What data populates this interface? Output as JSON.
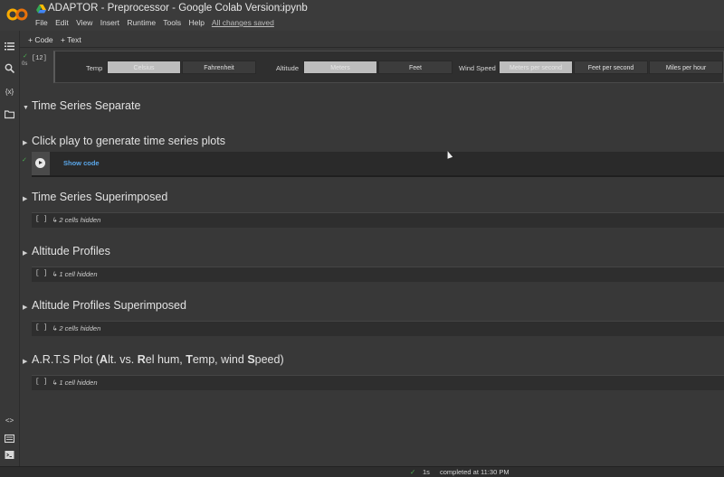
{
  "header": {
    "title": "ADAPTOR - Preprocessor - Google Colab Version.ipynb",
    "menu": [
      "File",
      "Edit",
      "View",
      "Insert",
      "Runtime",
      "Tools",
      "Help"
    ],
    "saved_status": "All changes saved"
  },
  "toolbar": {
    "code_label": "+ Code",
    "text_label": "+ Text"
  },
  "cell": {
    "exec_count": "[12]",
    "temp_label": "Temp",
    "temp_options": [
      "Celsius",
      "Fahrenheit"
    ],
    "altitude_label": "Altitude",
    "altitude_options": [
      "Meters",
      "Feet"
    ],
    "wind_label": "Wind Speed",
    "wind_options": [
      "Meters per second",
      "Feet per second",
      "Miles per hour"
    ]
  },
  "sections": [
    {
      "title": "Time Series Separate",
      "expanded": true
    },
    {
      "title": "Click play to generate time series plots",
      "expanded": false
    },
    {
      "title": "Time Series Superimposed",
      "hidden": "2 cells hidden"
    },
    {
      "title": "Altitude Profiles",
      "hidden": "1 cell hidden"
    },
    {
      "title": "Altitude Profiles Superimposed",
      "hidden": "2 cells hidden"
    },
    {
      "title_parts": [
        "A.R.T.S Plot (",
        "A",
        "lt. vs. ",
        "R",
        "el hum, ",
        "T",
        "emp, wind ",
        "S",
        "peed)"
      ],
      "hidden": "1 cell hidden"
    }
  ],
  "code_cell": {
    "show_code": "Show code"
  },
  "hidden_bracket": "[ ]",
  "status_bar": {
    "check": "✓",
    "duration": "1s",
    "completed": "completed at 11:30 PM"
  },
  "colors": {
    "accent": "#f9ab00",
    "link": "#5aa6e8",
    "ok": "#4caf50"
  }
}
